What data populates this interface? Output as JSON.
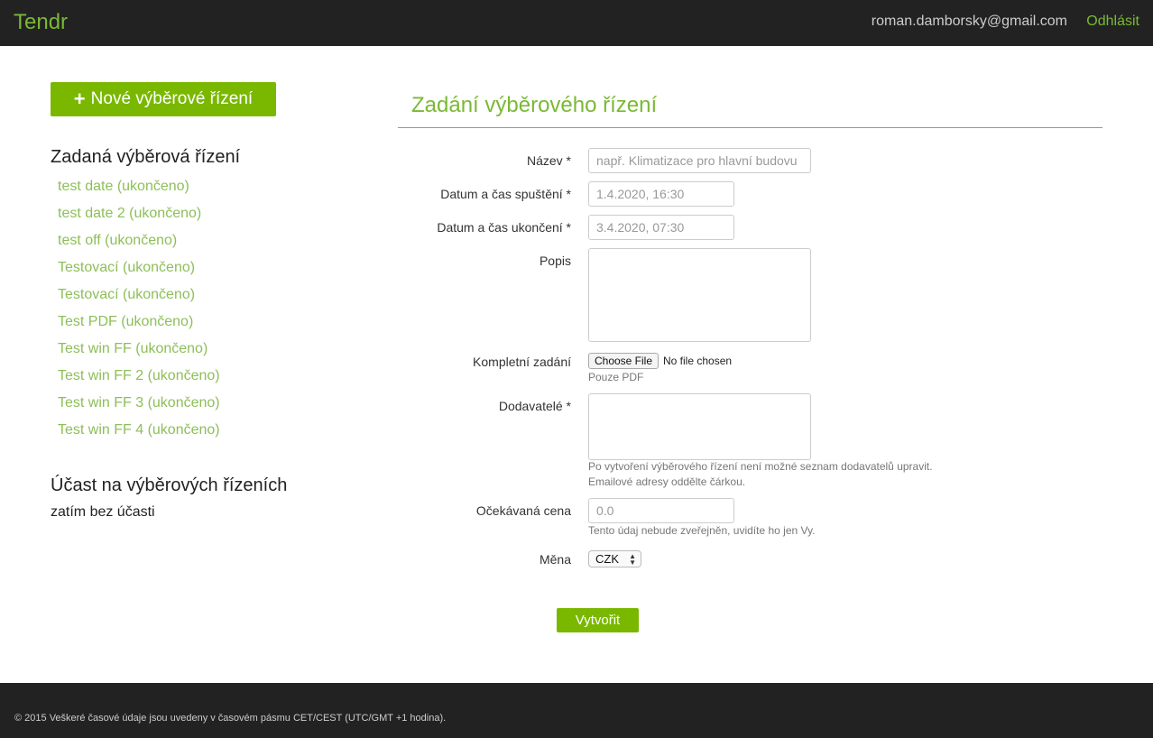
{
  "navbar": {
    "brand": "Tendr",
    "user_email": "roman.damborsky@gmail.com",
    "logout_label": "Odhlásit"
  },
  "sidebar": {
    "new_button_label": "Nové výběrové řízení",
    "submitted_heading": "Zadaná výběrová řízení",
    "submitted_items": [
      "test date (ukončeno)",
      "test date 2 (ukončeno)",
      "test off (ukončeno)",
      "Testovací (ukončeno)",
      "Testovací (ukončeno)",
      "Test PDF (ukončeno)",
      "Test win FF (ukončeno)",
      "Test win FF 2 (ukončeno)",
      "Test win FF 3 (ukončeno)",
      "Test win FF 4 (ukončeno)"
    ],
    "participation_heading": "Účast na výběrových řízeních",
    "participation_empty": "zatím bez účasti"
  },
  "form": {
    "title": "Zadání výběrového řízení",
    "name_label": "Název *",
    "name_placeholder": "např. Klimatizace pro hlavní budovu",
    "start_label": "Datum a čas spuštění *",
    "start_value": "1.4.2020, 16:30",
    "end_label": "Datum a čas ukončení *",
    "end_value": "3.4.2020, 07:30",
    "description_label": "Popis",
    "description_value": "",
    "spec_label": "Kompletní zadání",
    "file_button_label": "Choose File",
    "file_none_label": "No file chosen",
    "file_help": "Pouze PDF",
    "suppliers_label": "Dodavatelé *",
    "suppliers_value": "",
    "suppliers_help_1": "Po vytvoření výběrového řízení není možné seznam dodavatelů upravit.",
    "suppliers_help_2": "Emailové adresy oddělte čárkou.",
    "price_label": "Očekávaná cena",
    "price_placeholder": "0.0",
    "price_help": "Tento údaj nebude zveřejněn, uvidíte ho jen Vy.",
    "currency_label": "Měna",
    "currency_value": "CZK",
    "submit_label": "Vytvořit"
  },
  "footer": {
    "text": "© 2015 Veškeré časové údaje jsou uvedeny v časovém pásmu CET/CEST (UTC/GMT +1 hodina)."
  },
  "colors": {
    "accent_green": "#7ab934",
    "button_green": "#7ab800",
    "link_green": "#8dbf58",
    "navbar_bg": "#222222"
  }
}
